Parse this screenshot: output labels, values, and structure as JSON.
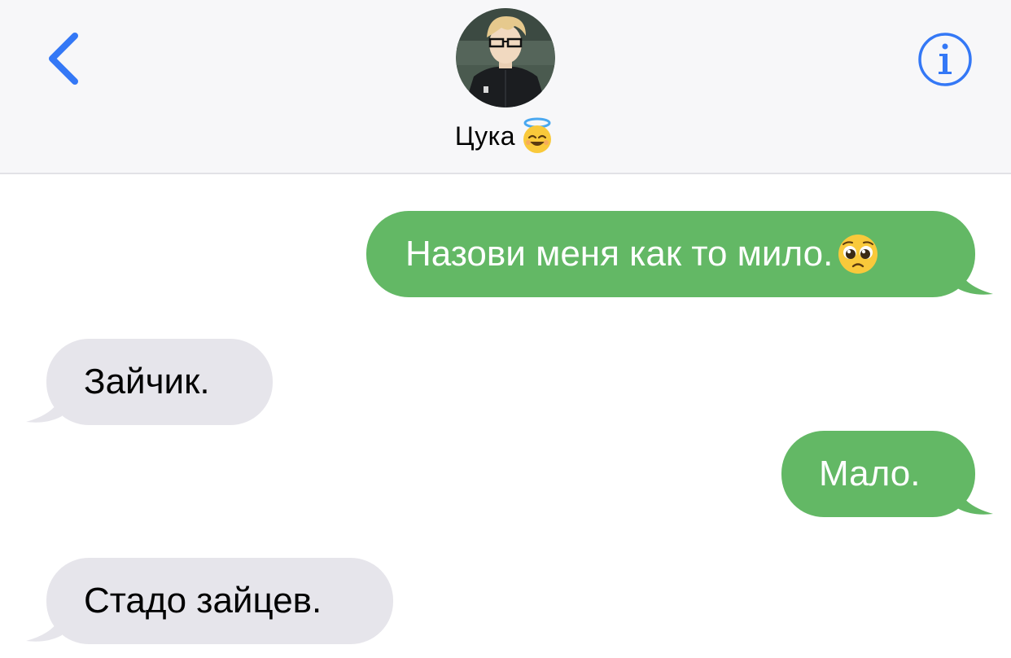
{
  "header": {
    "back_icon": "chevron-left-icon",
    "info_icon": "info-circle-icon",
    "contact_name": "Цука",
    "contact_emoji": "smiling-face-with-halo",
    "accent_color": "#3478f6"
  },
  "messages": [
    {
      "direction": "outgoing",
      "text": "Назови меня как то мило.",
      "emoji": "pleading-face"
    },
    {
      "direction": "incoming",
      "text": "Зайчик."
    },
    {
      "direction": "outgoing",
      "text": "Мало."
    },
    {
      "direction": "incoming",
      "text": "Стадо зайцев."
    }
  ],
  "colors": {
    "outgoing_bubble": "#63b865",
    "incoming_bubble": "#e6e5eb",
    "header_bg": "#f7f7f9"
  }
}
